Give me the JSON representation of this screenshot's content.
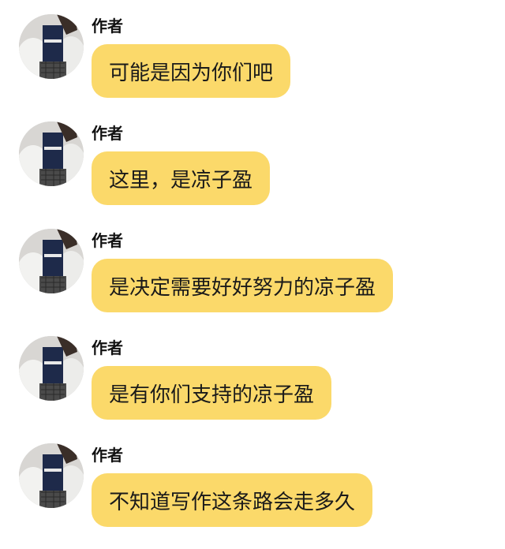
{
  "theme": {
    "bubble_color": "#fbd96a",
    "text_color": "#1a1a1a",
    "background": "#ffffff"
  },
  "messages": [
    {
      "sender": "作者",
      "avatar_icon": "user-avatar-icon",
      "text": "可能是因为你们吧"
    },
    {
      "sender": "作者",
      "avatar_icon": "user-avatar-icon",
      "text": "这里，是凉子盈"
    },
    {
      "sender": "作者",
      "avatar_icon": "user-avatar-icon",
      "text": "是决定需要好好努力的凉子盈"
    },
    {
      "sender": "作者",
      "avatar_icon": "user-avatar-icon",
      "text": "是有你们支持的凉子盈"
    },
    {
      "sender": "作者",
      "avatar_icon": "user-avatar-icon",
      "text": "不知道写作这条路会走多久"
    }
  ]
}
